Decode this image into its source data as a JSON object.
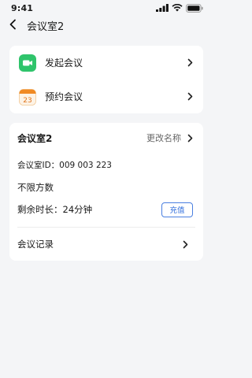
{
  "status_bar": {
    "time": "9:41"
  },
  "nav": {
    "title": "会议室2"
  },
  "actions": [
    {
      "label": "发起会议",
      "icon": "video-camera-icon",
      "color": "#2fc46b"
    },
    {
      "label": "预约会议",
      "icon": "calendar-icon",
      "calendar_day": "23",
      "color": "#f08a24"
    }
  ],
  "room": {
    "name": "会议室2",
    "rename_label": "更改名称",
    "id_label": "会议室ID：009 003 223",
    "capacity": "不限方数",
    "remaining": "剩余时长：24分钟",
    "recharge_label": "充值",
    "records_label": "会议记录"
  },
  "colors": {
    "accent": "#2f6ddc",
    "background": "#f4f5f7"
  }
}
